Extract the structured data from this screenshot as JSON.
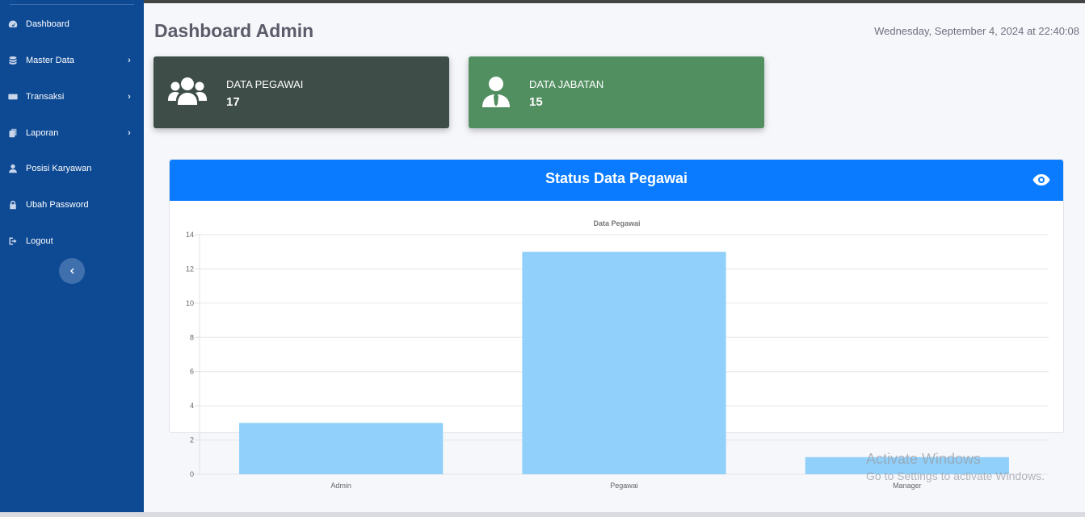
{
  "sidebar": {
    "items": [
      {
        "label": "Dashboard",
        "icon": "tachometer-icon"
      },
      {
        "label": "Master Data",
        "icon": "database-icon"
      },
      {
        "label": "Transaksi",
        "icon": "keyboard-icon"
      },
      {
        "label": "Laporan",
        "icon": "copy-icon"
      },
      {
        "label": "Posisi Karyawan",
        "icon": "user-icon"
      },
      {
        "label": "Ubah Password",
        "icon": "lock-icon"
      },
      {
        "label": "Logout",
        "icon": "sign-out-icon"
      }
    ]
  },
  "header": {
    "title": "Dashboard Admin",
    "datetime": "Wednesday, September 4, 2024 at 22:40:08"
  },
  "cards": [
    {
      "label": "DATA PEGAWAI",
      "value": "17",
      "color": "#3e4d48"
    },
    {
      "label": "DATA JABATAN",
      "value": "15",
      "color": "#528f60"
    }
  ],
  "panel": {
    "title": "Status Data Pegawai"
  },
  "chart_data": {
    "type": "bar",
    "title": "Data Pegawai",
    "categories": [
      "Admin",
      "Pegawai",
      "Manager"
    ],
    "values": [
      3,
      13,
      1
    ],
    "ylim": [
      0,
      14
    ],
    "yticks": [
      0,
      2,
      4,
      6,
      8,
      10,
      12,
      14
    ],
    "grid": true,
    "bar_color": "#90d0fb"
  },
  "watermark": {
    "line1": "Activate Windows",
    "line2": "Go to Settings to activate Windows."
  },
  "colors": {
    "sidebar": "#0e4a94",
    "accent": "#0a7bff"
  }
}
